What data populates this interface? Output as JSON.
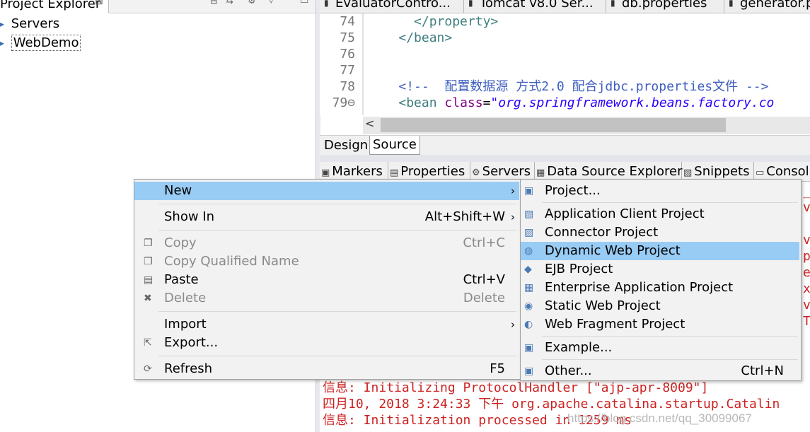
{
  "project_explorer": {
    "tab_label": "Project Explorer",
    "close_glyph": "⊠",
    "tree": [
      {
        "label": "Servers",
        "icon": "folder-icon"
      },
      {
        "label": "WebDemo",
        "icon": "project-icon"
      }
    ]
  },
  "editor_tabs": [
    {
      "label": "EvaluatorContro..."
    },
    {
      "label": "Tomcat v8.0 Ser..."
    },
    {
      "label": "db.properties"
    },
    {
      "label": "generator.p"
    }
  ],
  "editor": {
    "lines": [
      {
        "num": "74",
        "indent": "      ",
        "parts": [
          {
            "cls": "tag",
            "text": "</property>"
          }
        ]
      },
      {
        "num": "75",
        "indent": "    ",
        "parts": [
          {
            "cls": "tag",
            "text": "</bean>"
          }
        ]
      },
      {
        "num": "76",
        "indent": "",
        "parts": []
      },
      {
        "num": "77",
        "indent": "",
        "parts": []
      },
      {
        "num": "78",
        "indent": "    ",
        "parts": [
          {
            "cls": "cm",
            "text": "<!--  配置数据源 方式2.0 配合jdbc.properties文件 -->"
          }
        ]
      },
      {
        "num": "79⊖",
        "indent": "    ",
        "parts": [
          {
            "cls": "tag",
            "text": "<bean "
          },
          {
            "cls": "attr",
            "text": "class"
          },
          {
            "cls": "",
            "text": "="
          },
          {
            "cls": "str",
            "text": "\"org.springframework.beans.factory.co"
          }
        ]
      }
    ],
    "scroll_left": "<"
  },
  "bottom_tabs": {
    "design": "Design",
    "source": "Source"
  },
  "view_tabs": [
    {
      "label": "Markers",
      "icon": "markers-icon",
      "glyph": "▣"
    },
    {
      "label": "Properties",
      "icon": "properties-icon",
      "glyph": "▤"
    },
    {
      "label": "Servers",
      "icon": "servers-icon",
      "glyph": "⚙"
    },
    {
      "label": "Data Source Explorer",
      "icon": "datasource-icon",
      "glyph": "▦"
    },
    {
      "label": "Snippets",
      "icon": "snippets-icon",
      "glyph": "▧"
    },
    {
      "label": "Consol",
      "icon": "console-icon",
      "glyph": "▭"
    }
  ],
  "console": {
    "lines": [
      {
        "prefix": "信息:",
        "text": " Initializing ProtocolHandler [\"ajp-apr-8009\"]",
        "color": "#cc2222"
      },
      {
        "prefix": "四月10, 2018 3:24:33 下午",
        "text": " org.apache.catalina.startup.Catalin",
        "color": "#cc2222"
      },
      {
        "prefix": "信息:",
        "text": " Initialization processed in 1259 ms",
        "color": "#cc2222"
      }
    ],
    "edge_glyphs": [
      "_1",
      "vc",
      "",
      "vc",
      "p",
      "et",
      "x",
      "vc",
      "Tu",
      ""
    ],
    "watermark": "https://blog.csdn.net/qq_30099067"
  },
  "context_menu": {
    "items": [
      {
        "id": "new",
        "label": "New",
        "shortcut": "",
        "submenu": true,
        "selected": true,
        "disabled": false,
        "icon": ""
      },
      {
        "sep": true
      },
      {
        "id": "show-in",
        "label": "Show In",
        "shortcut": "Alt+Shift+W",
        "submenu": true,
        "selected": false,
        "disabled": false,
        "icon": ""
      },
      {
        "sep": true
      },
      {
        "id": "copy",
        "label": "Copy",
        "shortcut": "Ctrl+C",
        "submenu": false,
        "selected": false,
        "disabled": true,
        "icon": "copy-icon"
      },
      {
        "id": "copy-qualified-name",
        "label": "Copy Qualified Name",
        "shortcut": "",
        "submenu": false,
        "selected": false,
        "disabled": true,
        "icon": "copy-qualified-icon"
      },
      {
        "id": "paste",
        "label": "Paste",
        "shortcut": "Ctrl+V",
        "submenu": false,
        "selected": false,
        "disabled": false,
        "icon": "paste-icon"
      },
      {
        "id": "delete",
        "label": "Delete",
        "shortcut": "Delete",
        "submenu": false,
        "selected": false,
        "disabled": true,
        "icon": "delete-icon"
      },
      {
        "sep": true
      },
      {
        "id": "import",
        "label": "Import",
        "shortcut": "",
        "submenu": true,
        "selected": false,
        "disabled": false,
        "icon": ""
      },
      {
        "id": "export",
        "label": "Export...",
        "shortcut": "",
        "submenu": false,
        "selected": false,
        "disabled": false,
        "icon": "export-icon"
      },
      {
        "sep": true
      },
      {
        "id": "refresh",
        "label": "Refresh",
        "shortcut": "F5",
        "submenu": false,
        "selected": false,
        "disabled": false,
        "icon": "refresh-icon"
      }
    ]
  },
  "new_submenu": {
    "items": [
      {
        "id": "project",
        "label": "Project...",
        "shortcut": "",
        "selected": false,
        "icon": "new-project-icon"
      },
      {
        "sep": true
      },
      {
        "id": "application-client-project",
        "label": "Application Client Project",
        "shortcut": "",
        "selected": false,
        "icon": "app-client-project-icon"
      },
      {
        "id": "connector-project",
        "label": "Connector Project",
        "shortcut": "",
        "selected": false,
        "icon": "connector-project-icon"
      },
      {
        "id": "dynamic-web-project",
        "label": "Dynamic Web Project",
        "shortcut": "",
        "selected": true,
        "icon": "dynamic-web-project-icon"
      },
      {
        "id": "ejb-project",
        "label": "EJB Project",
        "shortcut": "",
        "selected": false,
        "icon": "ejb-project-icon"
      },
      {
        "id": "enterprise-application-project",
        "label": "Enterprise Application Project",
        "shortcut": "",
        "selected": false,
        "icon": "enterprise-app-project-icon"
      },
      {
        "id": "static-web-project",
        "label": "Static Web Project",
        "shortcut": "",
        "selected": false,
        "icon": "static-web-project-icon"
      },
      {
        "id": "web-fragment-project",
        "label": "Web Fragment Project",
        "shortcut": "",
        "selected": false,
        "icon": "web-fragment-project-icon"
      },
      {
        "sep": true
      },
      {
        "id": "example",
        "label": "Example...",
        "shortcut": "",
        "selected": false,
        "icon": "example-icon"
      },
      {
        "sep": true
      },
      {
        "id": "other",
        "label": "Other...",
        "shortcut": "Ctrl+N",
        "selected": false,
        "icon": "other-wizard-icon"
      }
    ]
  }
}
